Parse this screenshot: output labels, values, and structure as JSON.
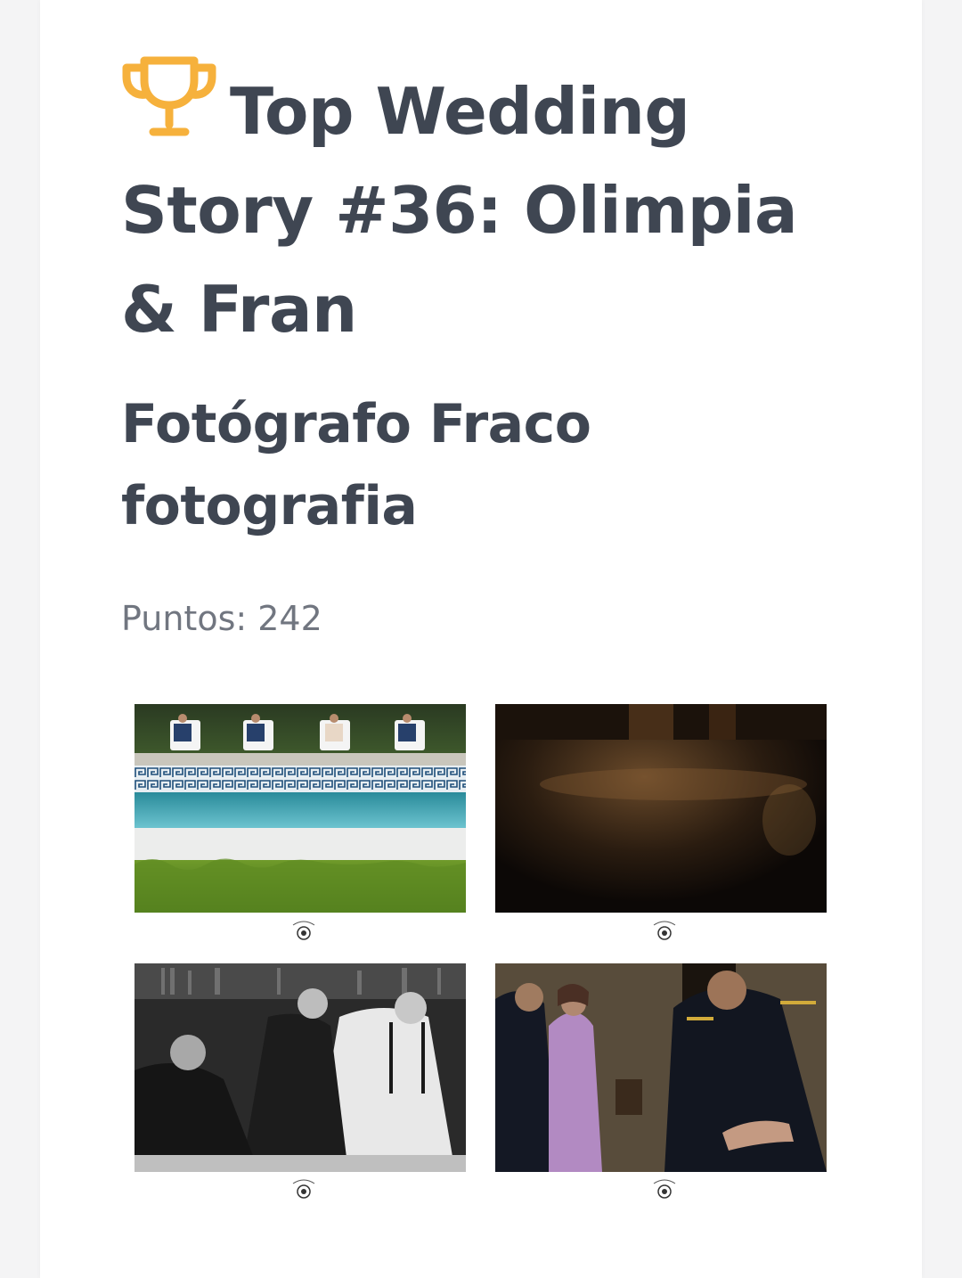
{
  "story": {
    "title": "Top Wedding Story #36: Olimpia & Fran",
    "subtitle": "Fotógrafo Fraco fotografia",
    "points_label": "Puntos: 242",
    "trophy_icon": "trophy-icon",
    "accent_color": "#f6b13c",
    "text_color": "#3f4652"
  },
  "gallery": {
    "photos": [
      {
        "subject": "pool-loungers"
      },
      {
        "subject": "dark-floor"
      },
      {
        "subject": "groomsmen-drinking"
      },
      {
        "subject": "mother-and-groom"
      }
    ],
    "watermark": "wedding-story-seal"
  }
}
